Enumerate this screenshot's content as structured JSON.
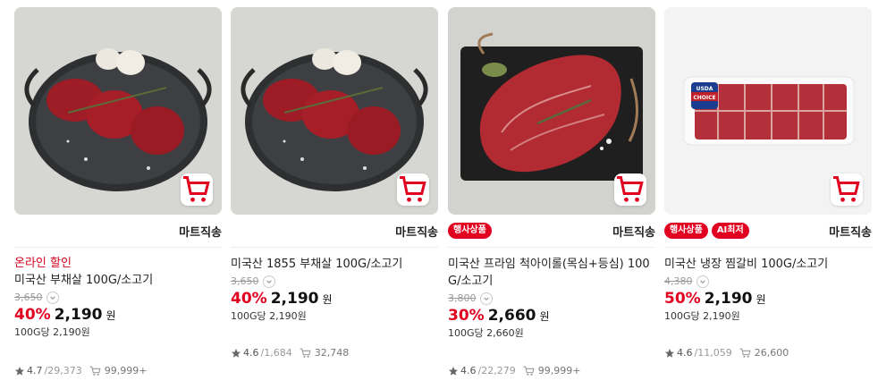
{
  "products": [
    {
      "badges": [],
      "shipping": "마트직송",
      "promo": "온라인 할인",
      "name": "미국산 부채살 100G/소고기",
      "original_price": "3,650",
      "discount": "40%",
      "price": "2,190",
      "currency": "원",
      "unit_price": "100G당 2,190원",
      "rating": "4.7",
      "review_count": "/29,373",
      "purchase_count": "99,999+",
      "image": "flat-iron-steak-on-pan"
    },
    {
      "badges": [],
      "shipping": "마트직송",
      "promo": "",
      "name": "미국산 1855 부채살 100G/소고기",
      "original_price": "3,650",
      "discount": "40%",
      "price": "2,190",
      "currency": "원",
      "unit_price": "100G당 2,190원",
      "rating": "4.6",
      "review_count": "/1,684",
      "purchase_count": "32,748",
      "image": "flat-iron-steak-on-pan"
    },
    {
      "badges": [
        "행사상품"
      ],
      "shipping": "마트직송",
      "promo": "",
      "name": "미국산 프라임 척아이롤(목심+등심) 100G/소고기",
      "original_price": "3,800",
      "discount": "30%",
      "price": "2,660",
      "currency": "원",
      "unit_price": "100G당 2,660원",
      "rating": "4.6",
      "review_count": "/22,279",
      "purchase_count": "99,999+",
      "image": "chuck-eye-roll-on-board"
    },
    {
      "badges": [
        "행사상품",
        "AI최저"
      ],
      "shipping": "마트직송",
      "promo": "",
      "name": "미국산 냉장 찜갈비 100G/소고기",
      "original_price": "4,380",
      "discount": "50%",
      "price": "2,190",
      "currency": "원",
      "unit_price": "100G당 2,190원",
      "rating": "4.6",
      "review_count": "/11,059",
      "purchase_count": "26,600",
      "image": "short-ribs-in-tray",
      "image_label": "USDA CHOICE"
    }
  ],
  "colors": {
    "accent": "#e1001f",
    "promo": "#d6001c"
  }
}
